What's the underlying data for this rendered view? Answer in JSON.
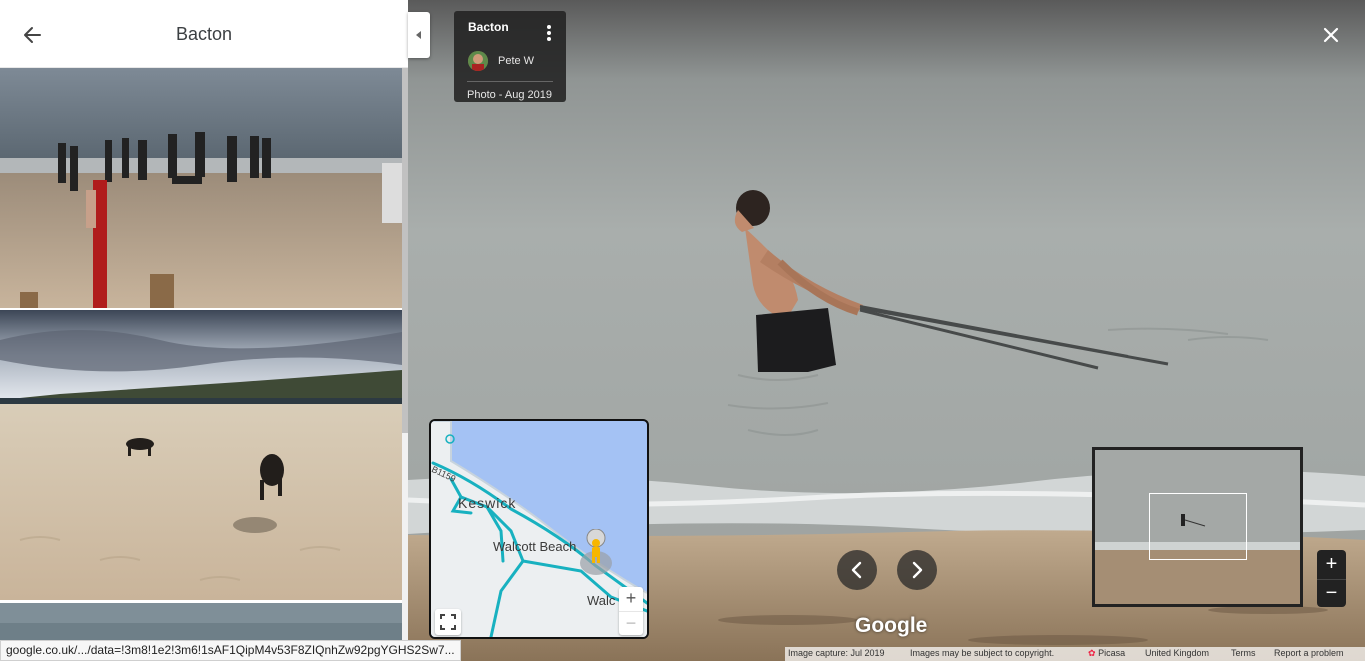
{
  "panel": {
    "title": "Bacton",
    "back_icon": "arrow-left-icon"
  },
  "photo_info": {
    "title": "Bacton",
    "author": "Pete W",
    "date": "Photo - Aug 2019",
    "menu_icon": "more-vert-icon"
  },
  "minimap": {
    "labels": {
      "keswick": "Keswick",
      "walcott_beach": "Walcott Beach",
      "walc": "Walc",
      "road": "B1159"
    },
    "zoom_in": "+",
    "zoom_out": "−",
    "fullscreen_icon": "fullscreen-icon",
    "pegman_icon": "pegman-icon"
  },
  "viewer": {
    "close_icon": "close-icon",
    "prev_icon": "chevron-left-icon",
    "next_icon": "chevron-right-icon",
    "logo": "Google",
    "zoom_in": "+",
    "zoom_out": "−"
  },
  "footer": {
    "capture": "Image capture: Jul 2019",
    "copyright": "Images may be subject to copyright.",
    "picasa": "Picasa",
    "region": "United Kingdom",
    "terms": "Terms",
    "report": "Report a problem"
  },
  "status_bar": {
    "url": "google.co.uk/.../data=!3m8!1e2!3m6!1sAF1QipM4v53F8ZIQnhZw92pgYGHS2Sw7..."
  }
}
